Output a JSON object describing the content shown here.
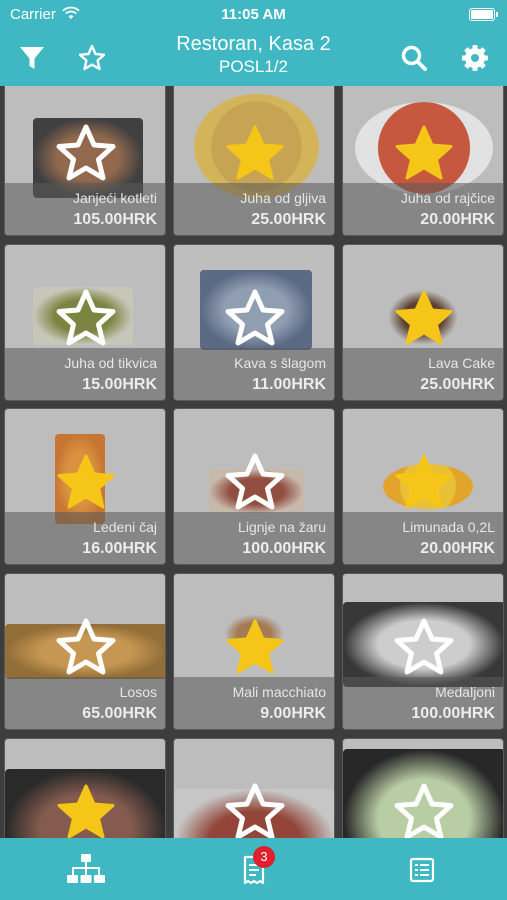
{
  "status_bar": {
    "carrier": "Carrier",
    "time": "11:05 AM"
  },
  "nav": {
    "title": "Restoran, Kasa 2",
    "subtitle": "POSL1/2"
  },
  "products": [
    {
      "name": "Janjeći kotleti",
      "price": "105.00HRK",
      "favorite": false
    },
    {
      "name": "Juha od gljiva",
      "price": "25.00HRK",
      "favorite": true
    },
    {
      "name": "Juha od rajčice",
      "price": "20.00HRK",
      "favorite": true
    },
    {
      "name": "Juha od tikvica",
      "price": "15.00HRK",
      "favorite": false
    },
    {
      "name": "Kava s šlagom",
      "price": "11.00HRK",
      "favorite": false
    },
    {
      "name": "Lava Cake",
      "price": "25.00HRK",
      "favorite": true
    },
    {
      "name": "Ledeni čaj",
      "price": "16.00HRK",
      "favorite": true
    },
    {
      "name": "Lignje na žaru",
      "price": "100.00HRK",
      "favorite": false
    },
    {
      "name": "Limunada 0,2L",
      "price": "20.00HRK",
      "favorite": true
    },
    {
      "name": "Losos",
      "price": "65.00HRK",
      "favorite": false
    },
    {
      "name": "Mali macchiato",
      "price": "9.00HRK",
      "favorite": true
    },
    {
      "name": "Medaljoni",
      "price": "100.00HRK",
      "favorite": false
    },
    {
      "name": "",
      "price": "",
      "favorite": true
    },
    {
      "name": "",
      "price": "",
      "favorite": false
    },
    {
      "name": "",
      "price": "",
      "favorite": false
    }
  ],
  "tab_bar": {
    "receipt_badge": "3"
  },
  "colors": {
    "accent": "#3fb8c4",
    "star_gold": "#f5c518",
    "badge_red": "#e0202e"
  },
  "icons": {
    "filter": "filter-icon",
    "favorites": "star-outline-icon",
    "search": "search-icon",
    "settings": "gear-icon",
    "tab1": "hierarchy-icon",
    "tab2": "receipt-icon",
    "tab3": "list-icon"
  }
}
